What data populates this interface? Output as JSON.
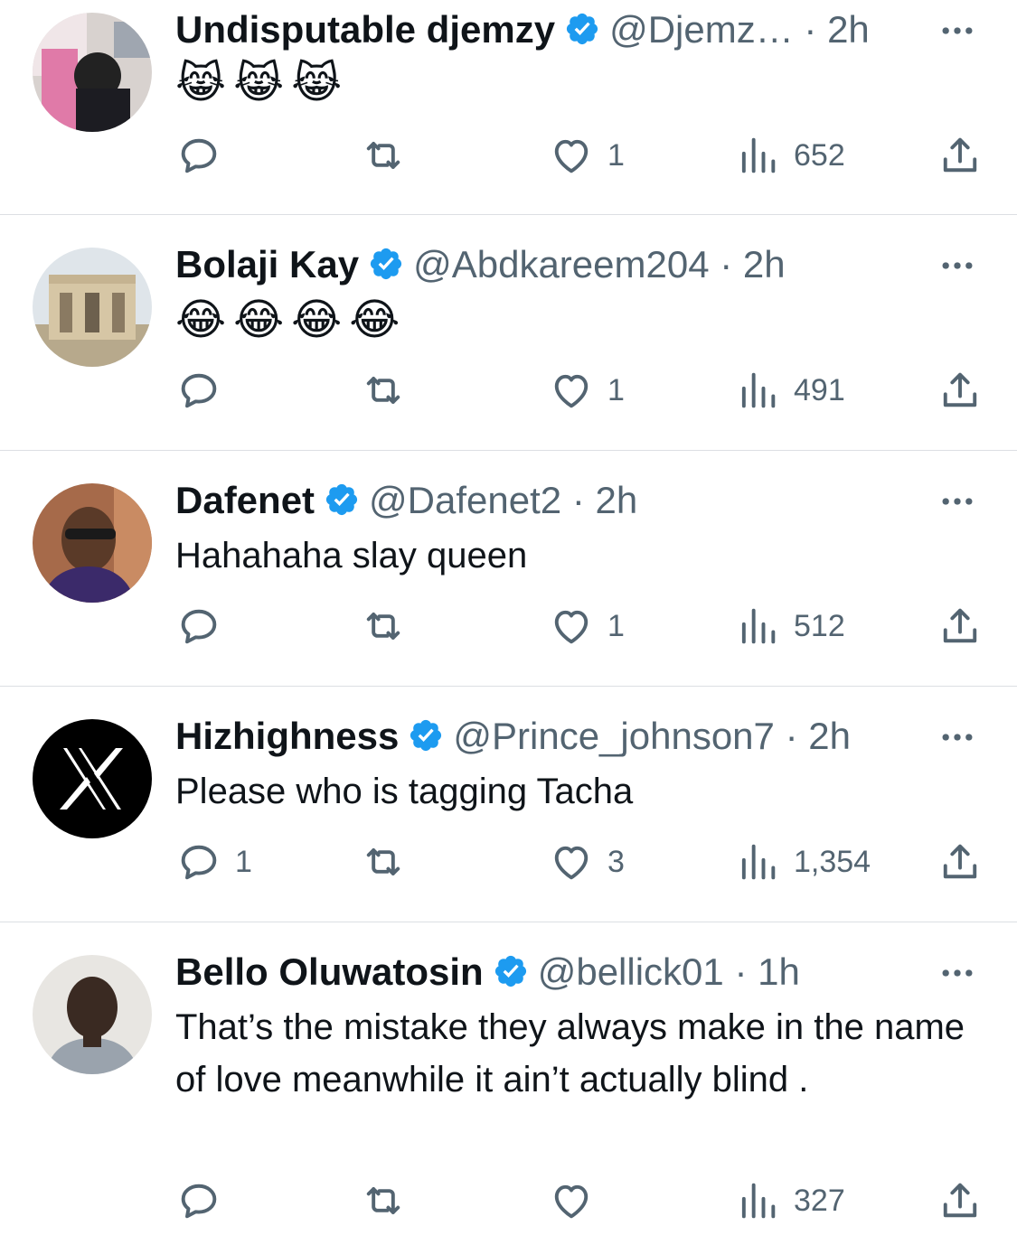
{
  "tweets": [
    {
      "name": "Undisputable djemzy",
      "handle": "@Djemz…",
      "dot": "·",
      "time": "2h",
      "text": "",
      "emoji": "😹😹😹",
      "replies": "",
      "likes": "1",
      "views": "652"
    },
    {
      "name": "Bolaji Kay",
      "handle": "@Abdkareem204",
      "dot": "·",
      "time": "2h",
      "text": "",
      "emoji": "😂😂😂😂",
      "replies": "",
      "likes": "1",
      "views": "491"
    },
    {
      "name": "Dafenet",
      "handle": "@Dafenet2",
      "dot": "·",
      "time": "2h",
      "text": "Hahahaha slay queen",
      "emoji": "",
      "replies": "",
      "likes": "1",
      "views": "512"
    },
    {
      "name": "Hizhighness",
      "handle": "@Prince_johnson7",
      "dot": "·",
      "time": "2h",
      "text": "Please who is tagging Tacha",
      "emoji": "",
      "replies": "1",
      "likes": "3",
      "views": "1,354"
    },
    {
      "name": "Bello Oluwatosin",
      "handle": "@bellick01",
      "dot": "·",
      "time": "1h",
      "text": "That’s the mistake they always make in the name of love meanwhile it ain’t actually blind .",
      "emoji": "",
      "replies": "",
      "likes": "",
      "views": "327"
    }
  ],
  "colors": {
    "text_primary": "#0f1419",
    "text_secondary": "#536471",
    "verified": "#1d9bf0",
    "divider": "#dcdfe3"
  },
  "icons": [
    "verified-badge-icon",
    "more-icon",
    "reply-icon",
    "retweet-icon",
    "like-icon",
    "views-icon",
    "share-icon"
  ]
}
